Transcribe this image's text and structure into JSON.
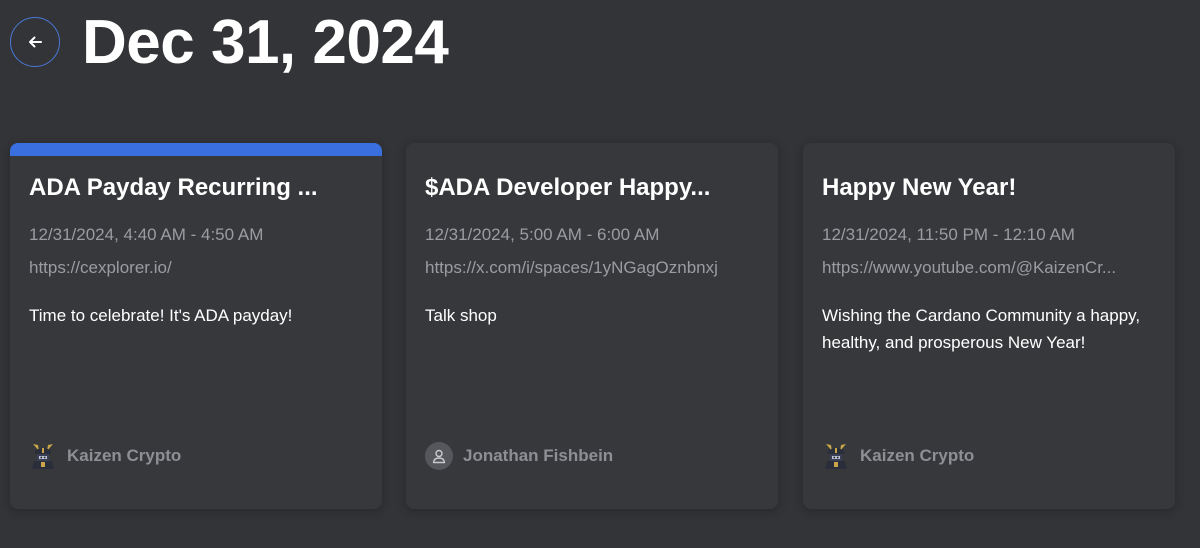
{
  "header": {
    "back_icon": "arrow-left-icon",
    "title": "Dec 31, 2024"
  },
  "colors": {
    "background": "#333437",
    "card": "#37383b",
    "accent": "#3a6fe0",
    "muted_text": "#9a9ca2"
  },
  "events": [
    {
      "title": "ADA Payday Recurring ...",
      "time": "12/31/2024, 4:40 AM - 4:50 AM",
      "link": "https://cexplorer.io/",
      "description": "Time to celebrate! It's ADA payday!",
      "author": "Kaizen Crypto",
      "avatar": "samurai-avatar-icon",
      "highlighted": true
    },
    {
      "title": "$ADA Developer Happy...",
      "time": "12/31/2024, 5:00 AM - 6:00 AM",
      "link": "https://x.com/i/spaces/1yNGagOznbnxj",
      "description": "Talk shop",
      "author": "Jonathan Fishbein",
      "avatar": "user-icon",
      "highlighted": false
    },
    {
      "title": "Happy New Year!",
      "time": "12/31/2024, 11:50 PM - 12:10 AM",
      "link": "https://www.youtube.com/@KaizenCr...",
      "description": "Wishing the Cardano Community a happy, healthy, and prosperous New Year!",
      "author": "Kaizen Crypto",
      "avatar": "samurai-avatar-icon",
      "highlighted": false
    }
  ]
}
